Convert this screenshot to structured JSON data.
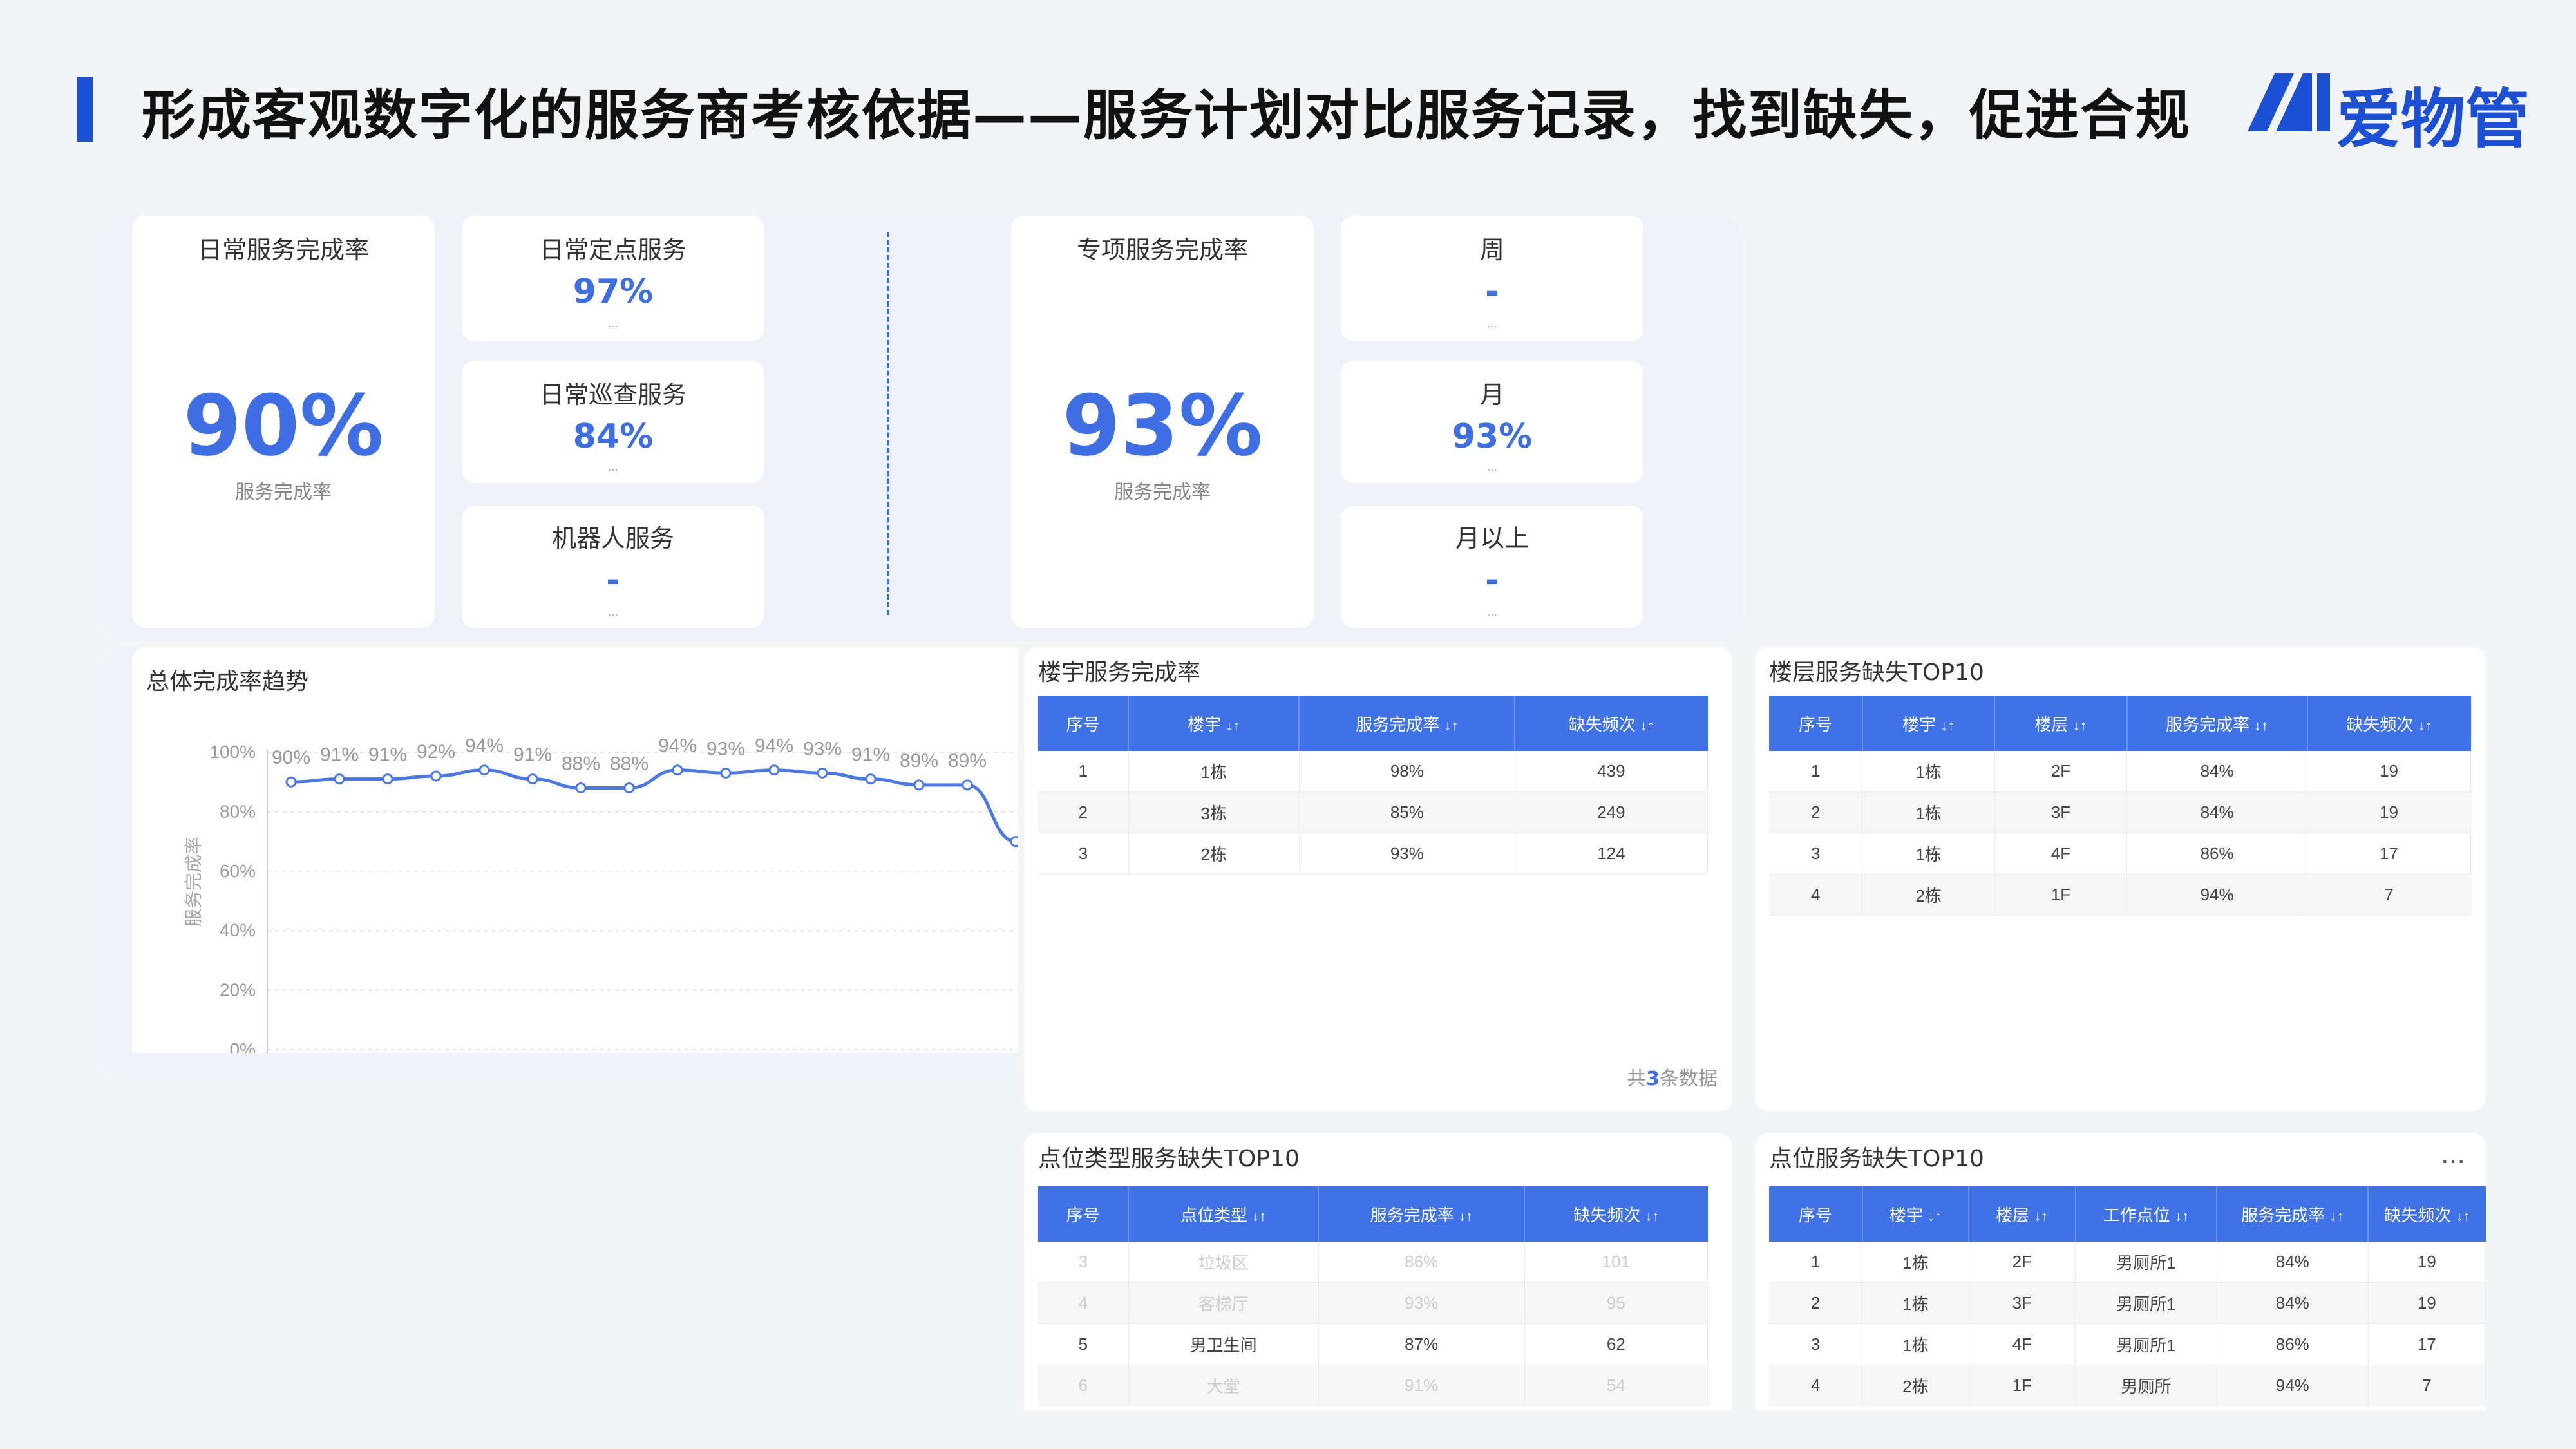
{
  "header": {
    "title": "形成客观数字化的服务商考核依据——服务计划对比服务记录，找到缺失，促进合规",
    "logo_text": "爱物管"
  },
  "colors": {
    "accent": "#1a4fd6",
    "value": "#3d6ee3",
    "table_header": "#3f72e6"
  },
  "daily": {
    "main_label": "日常服务完成率",
    "main_value": "90%",
    "main_sub": "服务完成率",
    "items": [
      {
        "label": "日常定点服务",
        "value": "97%",
        "sub": "..."
      },
      {
        "label": "日常巡查服务",
        "value": "84%",
        "sub": "..."
      },
      {
        "label": "机器人服务",
        "value": "-",
        "sub": "..."
      }
    ]
  },
  "special": {
    "main_label": "专项服务完成率",
    "main_value": "93%",
    "main_sub": "服务完成率",
    "items": [
      {
        "label": "周",
        "value": "-",
        "sub": "..."
      },
      {
        "label": "月",
        "value": "93%",
        "sub": "..."
      },
      {
        "label": "月以上",
        "value": "-",
        "sub": "..."
      }
    ]
  },
  "trend": {
    "title": "总体完成率趋势",
    "chart_data": {
      "type": "line",
      "title": "总体完成率趋势",
      "ylabel": "服务完成率",
      "ylim": [
        0,
        100
      ],
      "y_ticks": [
        "100%",
        "80%",
        "60%",
        "40%",
        "20%",
        "0%"
      ],
      "values": [
        90,
        91,
        91,
        92,
        94,
        91,
        88,
        88,
        94,
        93,
        94,
        93,
        91,
        89,
        89,
        70
      ],
      "data_labels": [
        "90%",
        "91%",
        "91%",
        "92%",
        "94%",
        "91%",
        "88%",
        "88%",
        "94%",
        "93%",
        "94%",
        "93%",
        "91%",
        "89%",
        "89%",
        ""
      ],
      "grid": true
    }
  },
  "building": {
    "title": "楼宇服务完成率",
    "headers": [
      "序号",
      "楼宇",
      "服务完成率",
      "缺失频次"
    ],
    "sort_mark": "↓↑",
    "rows": [
      [
        "1",
        "1栋",
        "98%",
        "439"
      ],
      [
        "2",
        "3栋",
        "85%",
        "249"
      ],
      [
        "3",
        "2栋",
        "93%",
        "124"
      ]
    ],
    "footer_prefix": "共",
    "footer_count": "3",
    "footer_suffix": "条数据"
  },
  "floor": {
    "title": "楼层服务缺失TOP10",
    "headers": [
      "序号",
      "楼宇",
      "楼层",
      "服务完成率",
      "缺失频次"
    ],
    "rows": [
      [
        "1",
        "1栋",
        "2F",
        "84%",
        "19"
      ],
      [
        "2",
        "1栋",
        "3F",
        "84%",
        "19"
      ],
      [
        "3",
        "1栋",
        "4F",
        "86%",
        "17"
      ],
      [
        "4",
        "2栋",
        "1F",
        "94%",
        "7"
      ]
    ]
  },
  "point_type": {
    "title": "点位类型服务缺失TOP10",
    "headers": [
      "序号",
      "点位类型",
      "服务完成率",
      "缺失频次"
    ],
    "rows": [
      [
        "3",
        "垃圾区",
        "86%",
        "101"
      ],
      [
        "4",
        "客梯厅",
        "93%",
        "95"
      ],
      [
        "5",
        "男卫生间",
        "87%",
        "62"
      ],
      [
        "6",
        "大堂",
        "91%",
        "54"
      ]
    ]
  },
  "point": {
    "title": "点位服务缺失TOP10",
    "more": "...",
    "headers": [
      "序号",
      "楼宇",
      "楼层",
      "工作点位",
      "服务完成率",
      "缺失频次"
    ],
    "rows": [
      [
        "1",
        "1栋",
        "2F",
        "男厕所1",
        "84%",
        "19"
      ],
      [
        "2",
        "1栋",
        "3F",
        "男厕所1",
        "84%",
        "19"
      ],
      [
        "3",
        "1栋",
        "4F",
        "男厕所1",
        "86%",
        "17"
      ],
      [
        "4",
        "2栋",
        "1F",
        "男厕所",
        "94%",
        "7"
      ]
    ]
  }
}
